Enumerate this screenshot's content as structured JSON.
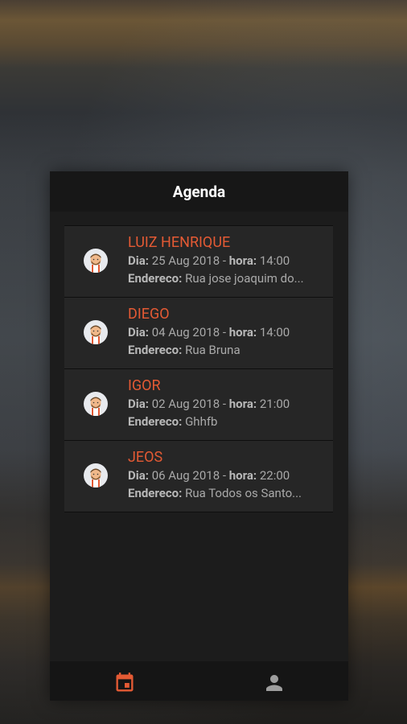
{
  "appbar": {
    "title": "Agenda"
  },
  "labels": {
    "dia": "Dia:",
    "hora": "hora:",
    "endereco": "Endereco:",
    "sep": " - "
  },
  "appointments": [
    {
      "name": "LUIZ HENRIQUE",
      "date": "25 Aug 2018",
      "time": "14:00",
      "address": "Rua jose joaquim do..."
    },
    {
      "name": "DIEGO",
      "date": "04 Aug 2018",
      "time": "14:00",
      "address": "Rua Bruna"
    },
    {
      "name": "IGOR",
      "date": "02 Aug 2018",
      "time": "21:00",
      "address": "Ghhfb"
    },
    {
      "name": "JEOS",
      "date": "06 Aug 2018",
      "time": "22:00",
      "address": "Rua Todos os Santo..."
    }
  ],
  "colors": {
    "accent": "#e45a34",
    "background": "#1c1c1c",
    "card": "#262626",
    "inactive_icon": "#9e9e9e"
  },
  "bottom_nav": [
    {
      "icon": "calendar-icon",
      "active": true
    },
    {
      "icon": "person-icon",
      "active": false
    }
  ]
}
